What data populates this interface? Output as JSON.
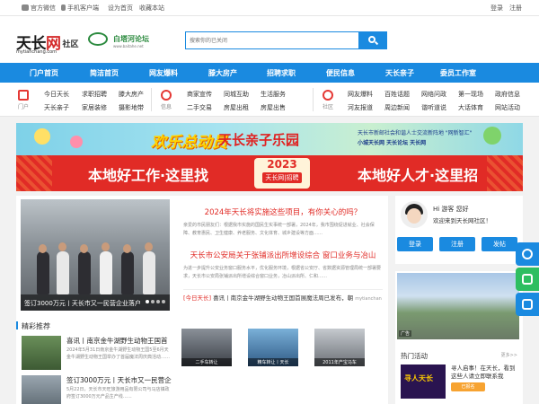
{
  "topbar": {
    "left": [
      "官方微信",
      "手机客户端",
      "设为首页",
      "收藏本站"
    ],
    "right": [
      "登录",
      "注册"
    ]
  },
  "logo": {
    "main_black": "天长",
    "main_red": "网",
    "suffix": "社区",
    "url": "mytianchang.com",
    "partner_name": "白塔河论坛",
    "partner_url": "www.baitahe.net"
  },
  "search": {
    "placeholder": "搜索你的已关闭"
  },
  "nav": [
    "门户首页",
    "简洁首页",
    "网友爆料",
    "滕大房产",
    "招聘求职",
    "便民信息",
    "天长亲子",
    "委员工作室"
  ],
  "subnav": {
    "cats": [
      {
        "icon": "home-icon",
        "label": "门户"
      },
      {
        "icon": "info-icon",
        "label": "信息"
      },
      {
        "icon": "community-icon",
        "label": "社区"
      }
    ],
    "menu1": [
      "今日天长",
      "求职招聘",
      "滕大房产",
      "天长亲子",
      "家居装修",
      "摄影地带"
    ],
    "menu2": [
      "商家宣传",
      "同城互助",
      "生活服务",
      "二手交易",
      "房屋出租",
      "房屋出售"
    ],
    "menu3": [
      "网友爆料",
      "百姓话题",
      "网络问政",
      "第一现场",
      "政府信息",
      "河友报道",
      "周边新闻",
      "谐听道说",
      "大话体育",
      "网站活动"
    ]
  },
  "banner1": {
    "title": "欢乐总动员",
    "title2": "天长亲子乐园",
    "line1": "天长市新邮社会和谐人士交流新阵地 \"网新智汇\"",
    "line2": "小城天长网 天长论坛 天长网"
  },
  "banner2": {
    "left": "本地好工作·这里找",
    "right": "本地好人才·这里招",
    "year": "2023",
    "tag": "天长网|招聘"
  },
  "main": {
    "photo_caption": "签订3000万元丨天长市又一民营企业落户",
    "news": [
      {
        "title": "2024年天长将实施这些项目，有你关心的吗？",
        "desc": "亲爱的市民朋友们：根据我市实施的国民生实事统一部署，2024年，我市围绕促进就业、社会保障、教育惠民、卫生健康、养老服务、文化体育、城乡建设等方面……"
      },
      {
        "title": "天长市公安局关于张铺派出所增设综合 窗口业务与冶山",
        "desc": "为进一步提升公安业务窗口服务水平，优化服务环境，根据省公安厅、省数据资源管理局统一部署要求，天长市公安局张铺派出所增设综合窗口业务，冶山派出所、仁和……"
      }
    ],
    "ticker": {
      "tag": "[今日天长]",
      "text": "喜讯丨南京金牛湖野生动物王国首展魔法周已发布，朝",
      "meta": "mytianchan"
    },
    "section_title": "精彩推荐",
    "features": [
      {
        "title": "喜讯丨南京金牛湖野生动物王国首",
        "desc": "2024年5月31日南京金牛湖野生动物王国5至6月天金牛湖野生动物王国举办了首届魔法周庆典活动……"
      },
      {
        "title": "签订3000万元丨天长市又一民营企",
        "desc": "5月22日，天长市天旺旅游用品有限公司与马店镇政府签订3000万元产品生产线……"
      }
    ],
    "thumbs": [
      "二手车转让",
      "精车转让丨天长",
      "2011年产宝马车"
    ]
  },
  "side": {
    "greeting": "Hi 游客  您好",
    "welcome": "欢迎来到天长网社区！",
    "buttons": [
      "登录",
      "注册",
      "发帖"
    ],
    "ad_tag": "广告",
    "hot": {
      "title": "热门活动",
      "more": "更多>>",
      "text": "寻人启事！在天长，看到这些人请立即联系我",
      "join": "已报名",
      "image_text": "寻人天长"
    }
  },
  "colors": {
    "primary": "#1a8ae0",
    "red": "#e12b26"
  }
}
